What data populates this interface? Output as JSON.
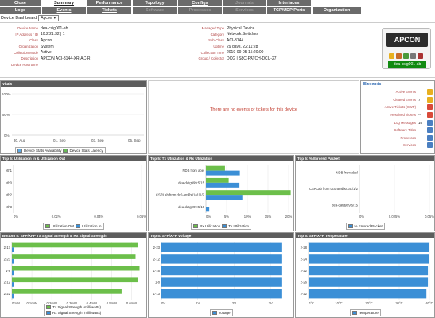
{
  "nav": {
    "row1": [
      {
        "label": "Close",
        "state": "normal"
      },
      {
        "label": "Summary",
        "state": "active"
      },
      {
        "label": "Performance",
        "state": "normal"
      },
      {
        "label": "Topology",
        "state": "normal"
      },
      {
        "label": "Configs",
        "state": "normal"
      },
      {
        "label": "Journals",
        "state": "dim"
      },
      {
        "label": "Interfaces",
        "state": "normal"
      }
    ],
    "row2": [
      {
        "label": "Logs",
        "state": "normal"
      },
      {
        "label": "Events",
        "state": "normal"
      },
      {
        "label": "Tickets",
        "state": "normal"
      },
      {
        "label": "Software",
        "state": "dim"
      },
      {
        "label": "Processes",
        "state": "dim"
      },
      {
        "label": "Services",
        "state": "dim"
      },
      {
        "label": "TCP/UDP Ports",
        "state": "normal"
      },
      {
        "label": "Organization",
        "state": "normal"
      }
    ]
  },
  "dashboard": {
    "label": "Device Dashboard",
    "value": "Apcon"
  },
  "device_info": {
    "left": [
      {
        "k": "Device Name",
        "v": "dea-csig001-ab"
      },
      {
        "k": "IP Address / ID",
        "v": "10.2.21.32 | 1"
      },
      {
        "k": "Class",
        "v": "Apcon"
      },
      {
        "k": "Organization",
        "v": "System"
      },
      {
        "k": "Collection Mode",
        "v": "Active"
      },
      {
        "k": "Description",
        "v": "APCON ACI-3144-XR-AC-R"
      },
      {
        "k": "Device Hostname",
        "v": ""
      }
    ],
    "right": [
      {
        "k": "Managed Type",
        "v": "Physical Device"
      },
      {
        "k": "Category",
        "v": "Network.Switches"
      },
      {
        "k": "Sub-Class",
        "v": "ACI-3144"
      },
      {
        "k": "Uptime",
        "v": "29 days, 22:11:28"
      },
      {
        "k": "Collection Time",
        "v": "2019-09-05 15:20:00"
      },
      {
        "k": "Group / Collector",
        "v": "DCG | S8C-PATCH-DCU-27"
      }
    ],
    "logo_text": "APCON",
    "host_badge": "dea-csig001-ab"
  },
  "vitals": {
    "title": "Vitals",
    "yticks": [
      "100%",
      "50%",
      "0%"
    ],
    "xticks": [
      "30. Aug",
      "01. Sep",
      "03. Sep",
      "05. Sep"
    ],
    "legend": [
      {
        "name": "Device Stats Availability",
        "color": "#5aa9e6"
      },
      {
        "name": "Device Stats Latency",
        "color": "#66bb55"
      }
    ]
  },
  "center_message": "There are no events or tickets for this device",
  "elements": {
    "title": "Elements",
    "rows": [
      {
        "label": "Active Events",
        "count": "",
        "icon": "warning-icon",
        "color": "#e8b020"
      },
      {
        "label": "Cleared Events",
        "count": "7",
        "icon": "warning-icon",
        "color": "#e8b020"
      },
      {
        "label": "Active Tickets (CWP)",
        "count": "--",
        "icon": "ticket-icon",
        "color": "#d94a3a"
      },
      {
        "label": "Resolved Tickets",
        "count": "--",
        "icon": "ticket-icon",
        "color": "#d94a3a"
      },
      {
        "label": "Log Messages",
        "count": "16",
        "icon": "log-icon",
        "color": "#4a7fc1"
      },
      {
        "label": "Software Titles",
        "count": "--",
        "icon": "software-icon",
        "color": "#4a7fc1"
      },
      {
        "label": "Processes",
        "count": "--",
        "icon": "process-icon",
        "color": "#4a7fc1"
      },
      {
        "label": "Services",
        "count": "--",
        "icon": "service-icon",
        "color": "#4a7fc1"
      }
    ]
  },
  "chart_data": [
    {
      "type": "bar",
      "orientation": "horizontal",
      "title": "Top 5: Utilization In & Utilization Out",
      "categories": [
        "eth1",
        "eth0",
        "eth2",
        "eth3"
      ],
      "series": [
        {
          "name": "Utilization Out",
          "color": "#6cbf4a",
          "values": [
            0,
            0,
            0,
            0
          ]
        },
        {
          "name": "Utilization In",
          "color": "#3b8fd6",
          "values": [
            0,
            0,
            0,
            0
          ]
        }
      ],
      "xticks": [
        "0%",
        "0.02%",
        "0.04%",
        "0.06%"
      ],
      "xlim": [
        0,
        0.06
      ]
    },
    {
      "type": "bar",
      "orientation": "horizontal",
      "title": "Top 5: Tx Utilization & Rx Utilization",
      "categories": [
        "NDB from abel",
        "dea-datg999:5/15",
        "CSRLab from dc0-anslb01a1/1/2",
        "dea-datg999:5/16"
      ],
      "series": [
        {
          "name": "Rx Utilization",
          "color": "#6cbf4a",
          "values": [
            4.6,
            5.5,
            20.5,
            0
          ]
        },
        {
          "name": "Tx Utilization",
          "color": "#3b8fd6",
          "values": [
            8.2,
            8.1,
            8.8,
            0.8
          ]
        }
      ],
      "xticks": [
        "0%",
        "5%",
        "10%",
        "15%",
        "20%"
      ],
      "xlim": [
        0,
        20
      ]
    },
    {
      "type": "bar",
      "orientation": "horizontal",
      "title": "Top 5: % Errored Packet",
      "categories": [
        "NDB from abel",
        "CSRLab from dc0-anslb01a1/1/2",
        "dea-datg999:5/15"
      ],
      "series": [
        {
          "name": "% Errored Packet",
          "color": "#3b8fd6",
          "values": [
            0,
            0,
            0
          ]
        }
      ],
      "xticks": [
        "0%",
        "0.025%",
        "0.05%"
      ],
      "xlim": [
        0,
        0.05
      ]
    },
    {
      "type": "bar",
      "orientation": "horizontal",
      "title": "Bottom 5: SFP/XFP Tx Signal Strength & Rx Signal Strength",
      "categories": [
        "2-17",
        "2-23",
        "1-8",
        "2-12",
        "2-22"
      ],
      "series": [
        {
          "name": "Tx Signal Strength (milli watts)",
          "color": "#6cbf4a",
          "values": [
            0.63,
            0.62,
            0.64,
            0.63,
            0.55
          ]
        },
        {
          "name": "Rx Signal Strength (milli watts)",
          "color": "#3b8fd6",
          "values": [
            0.01,
            0.01,
            0.01,
            0.01,
            0.01
          ]
        }
      ],
      "xticks": [
        "0mW",
        "0.1mW",
        "0.2mW",
        "0.3mW",
        "0.4mW",
        "0.5mW",
        "0.6mW"
      ],
      "xlim": [
        0,
        0.65
      ]
    },
    {
      "type": "bar",
      "orientation": "horizontal",
      "title": "Top 5: SFP/XFP Voltage",
      "categories": [
        "2-23",
        "2-12",
        "1-16",
        "1-8",
        "1-13"
      ],
      "series": [
        {
          "name": "Voltage",
          "color": "#3b8fd6",
          "values": [
            3.3,
            3.3,
            3.3,
            3.3,
            3.3
          ]
        }
      ],
      "xticks": [
        "0V",
        "1V",
        "2V",
        "3V"
      ],
      "xlim": [
        0,
        3.5
      ]
    },
    {
      "type": "bar",
      "orientation": "horizontal",
      "title": "Top 5: SFP/XFP Temperature",
      "categories": [
        "2-28",
        "2-24",
        "2-22",
        "2-26",
        "2-22"
      ],
      "series": [
        {
          "name": "Temperature",
          "color": "#3b8fd6",
          "values": [
            40,
            40,
            39.5,
            39.5,
            39
          ]
        }
      ],
      "xticks": [
        "0°C",
        "10°C",
        "20°C",
        "30°C",
        "40°C"
      ],
      "xlim": [
        0,
        40
      ]
    }
  ]
}
